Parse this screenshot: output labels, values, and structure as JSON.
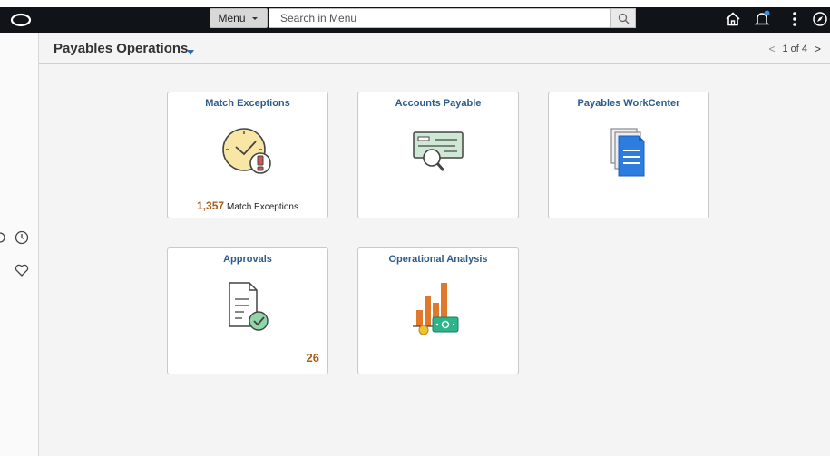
{
  "topbar": {
    "menu_label": "Menu",
    "search_placeholder": "Search in Menu"
  },
  "header": {
    "title": "Payables Operations",
    "pager": "1 of 4"
  },
  "tiles": [
    {
      "title": "Match Exceptions",
      "count": "1,357",
      "count_label": "Match Exceptions"
    },
    {
      "title": "Accounts Payable"
    },
    {
      "title": "Payables WorkCenter"
    },
    {
      "title": "Approvals",
      "badge": "26"
    },
    {
      "title": "Operational Analysis"
    }
  ],
  "colors": {
    "topbar": "#101418",
    "tile_title": "#2e5b8c",
    "count_accent": "#a65e1b",
    "notification_dot": "#3b8fe0"
  },
  "icons": [
    "logo-icon",
    "search-icon",
    "home-icon",
    "bell-icon",
    "kebab-menu-icon",
    "compass-icon",
    "history-icon",
    "heart-icon",
    "clock-alert-icon",
    "check-magnifier-icon",
    "document-stack-icon",
    "document-check-icon",
    "bar-chart-money-icon"
  ]
}
